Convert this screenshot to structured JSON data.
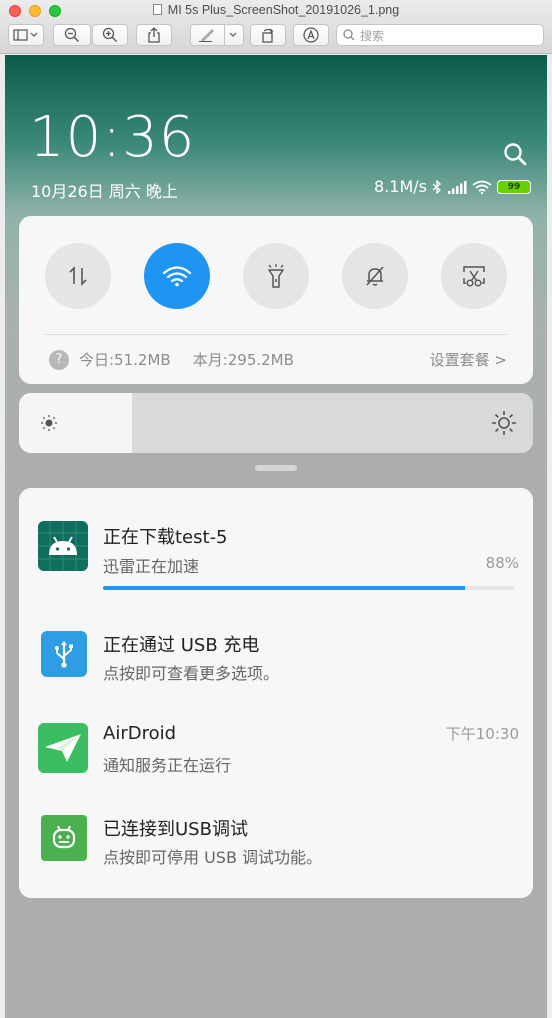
{
  "window": {
    "title": "MI 5s Plus_ScreenShot_20191026_1.png",
    "search_placeholder": "搜索"
  },
  "status": {
    "time": "10:36",
    "date": "10月26日 周六 晚上",
    "network_speed": "8.1M/s",
    "battery": "99"
  },
  "quick_settings": {
    "toggles": [
      {
        "name": "mobile-data",
        "icon": "data-arrows-icon",
        "active": false
      },
      {
        "name": "wifi",
        "icon": "wifi-icon",
        "active": true
      },
      {
        "name": "flashlight",
        "icon": "flashlight-icon",
        "active": false
      },
      {
        "name": "mute",
        "icon": "bell-off-icon",
        "active": false
      },
      {
        "name": "screenshot",
        "icon": "scissors-icon",
        "active": false
      }
    ],
    "data_today": "今日:51.2MB",
    "data_month": "本月:295.2MB",
    "plan_link": "设置套餐 >",
    "help": "?"
  },
  "brightness": {
    "level": 0.22
  },
  "notifications": [
    {
      "title": "正在下载test-5",
      "text": "迅雷正在加速",
      "percent": "88%",
      "progress": 0.88,
      "icon": "android-icon"
    },
    {
      "title": "正在通过  USB  充电",
      "text": "点按即可查看更多选项。",
      "icon": "usb-icon"
    },
    {
      "title": "AirDroid",
      "text": "通知服务正在运行",
      "time": "下午10:30",
      "icon": "airdroid-icon"
    },
    {
      "title": "已连接到USB调试",
      "text": "点按即可停用 USB 调试功能。",
      "icon": "android-debug-icon"
    }
  ],
  "colors": {
    "accent": "#1f95f3",
    "android_green": "#0f6e5e",
    "usb_blue": "#2f9de4",
    "airdroid_green": "#3dbd62",
    "debug_green": "#4caf50"
  }
}
